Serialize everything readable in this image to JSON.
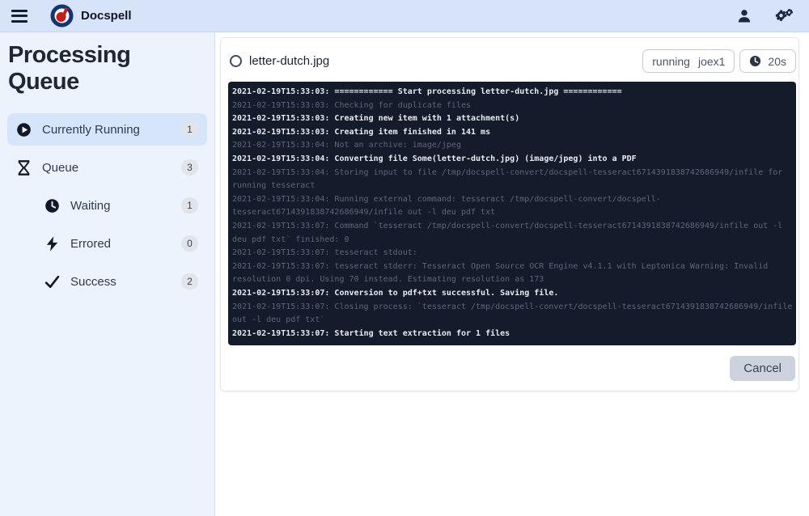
{
  "topbar": {
    "app_name": "Docspell",
    "icons": [
      "hamburger-menu-icon",
      "docspell-logo",
      "user-icon",
      "gears-icon"
    ]
  },
  "sidebar": {
    "title": "Processing Queue",
    "items": [
      {
        "label": "Currently Running",
        "count": "1",
        "icon": "play-circle-icon",
        "selected": true,
        "indent": false
      },
      {
        "label": "Queue",
        "count": "3",
        "icon": "hourglass-icon",
        "selected": false,
        "indent": false
      },
      {
        "label": "Waiting",
        "count": "1",
        "icon": "clock-icon",
        "selected": false,
        "indent": true
      },
      {
        "label": "Errored",
        "count": "0",
        "icon": "bolt-icon",
        "selected": false,
        "indent": true
      },
      {
        "label": "Success",
        "count": "2",
        "icon": "check-icon",
        "selected": false,
        "indent": true
      }
    ]
  },
  "job_card": {
    "filename": "letter-dutch.jpg",
    "state": "running",
    "worker": "joex1",
    "duration": "20s",
    "cancel_label": "Cancel",
    "log_lines": [
      {
        "emphasis": true,
        "text": "2021-02-19T15:33:03: ============ Start processing letter-dutch.jpg ============"
      },
      {
        "emphasis": false,
        "text": "2021-02-19T15:33:03: Checking for duplicate files"
      },
      {
        "emphasis": true,
        "text": "2021-02-19T15:33:03: Creating new item with 1 attachment(s)"
      },
      {
        "emphasis": true,
        "text": "2021-02-19T15:33:03: Creating item finished in 141 ms"
      },
      {
        "emphasis": false,
        "text": "2021-02-19T15:33:04: Not an archive: image/jpeg"
      },
      {
        "emphasis": true,
        "text": "2021-02-19T15:33:04: Converting file Some(letter-dutch.jpg) (image/jpeg) into a PDF"
      },
      {
        "emphasis": false,
        "text": "2021-02-19T15:33:04: Storing input to file /tmp/docspell-convert/docspell-tesseract6714391838742686949/infile for running tesseract"
      },
      {
        "emphasis": false,
        "text": "2021-02-19T15:33:04: Running external command: tesseract /tmp/docspell-convert/docspell-tesseract6714391838742686949/infile out -l deu pdf txt"
      },
      {
        "emphasis": false,
        "text": "2021-02-19T15:33:07: Command `tesseract /tmp/docspell-convert/docspell-tesseract6714391838742686949/infile out -l deu pdf txt` finished: 0"
      },
      {
        "emphasis": false,
        "text": "2021-02-19T15:33:07: tesseract stdout:"
      },
      {
        "emphasis": false,
        "text": "2021-02-19T15:33:07: tesseract stderr: Tesseract Open Source OCR Engine v4.1.1 with Leptonica Warning: Invalid resolution 0 dpi. Using 70 instead. Estimating resolution as 173"
      },
      {
        "emphasis": true,
        "text": "2021-02-19T15:33:07: Conversion to pdf+txt successful. Saving file."
      },
      {
        "emphasis": false,
        "text": "2021-02-19T15:33:07: Closing process: `tesseract /tmp/docspell-convert/docspell-tesseract6714391838742686949/infile out -l deu pdf txt`"
      },
      {
        "emphasis": true,
        "text": "2021-02-19T15:33:07: Starting text extraction for 1 files"
      }
    ]
  },
  "colors": {
    "topbar_bg": "#d7e3f8",
    "sidebar_bg": "#edf3fc",
    "selected_item_bg": "#d7e5fa",
    "log_bg": "#141b2b",
    "log_bright_text": "#e8ebf1",
    "log_dim_text": "#5d667b",
    "logo_navy": "#14356e",
    "logo_red": "#c41d1d",
    "cancel_button_bg": "#ccd3dd"
  }
}
